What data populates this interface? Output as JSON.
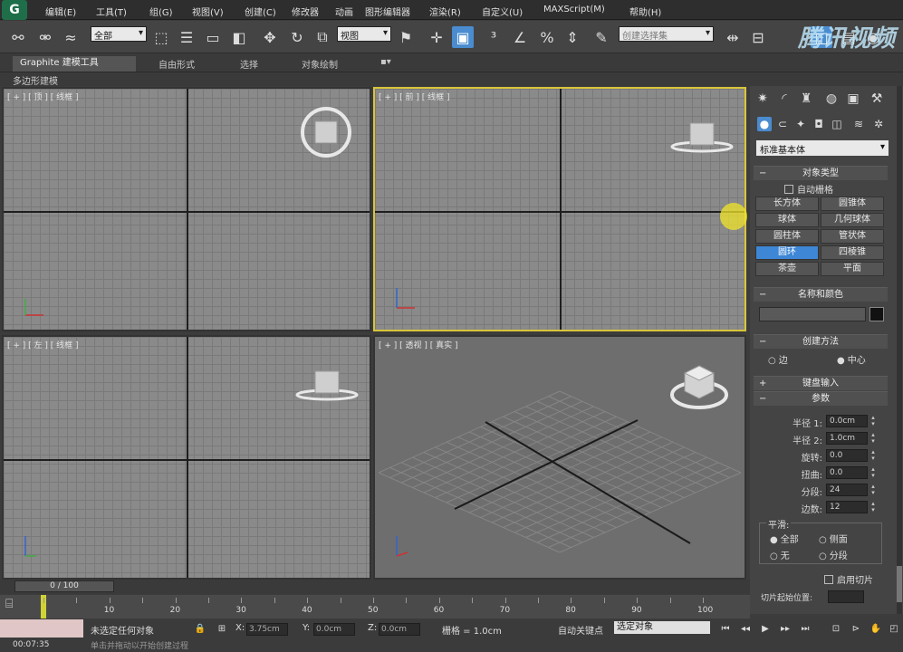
{
  "menu": {
    "logo": "G",
    "items": [
      "编辑(E)",
      "工具(T)",
      "组(G)",
      "视图(V)",
      "创建(C)",
      "修改器",
      "动画",
      "图形编辑器",
      "渲染(R)",
      "自定义(U)",
      "MAXScript(M)",
      "帮助(H)"
    ]
  },
  "toolbar": {
    "selection_filter": "全部",
    "ref_coord": "视图",
    "named_selection": "创建选择集",
    "watermark": "腾讯视频"
  },
  "ribbon": {
    "tabs": [
      "Graphite 建模工具",
      "自由形式",
      "选择",
      "对象绘制"
    ],
    "subtitle": "多边形建模"
  },
  "viewports": {
    "top": "[ + ] [ 顶 ] [ 线框 ]",
    "front": "[ + ] [ 前 ] [ 线框 ]",
    "left": "[ + ] [ 左 ] [ 线框 ]",
    "persp": "[ + ] [ 透视 ] [ 真实 ]"
  },
  "cmdpanel": {
    "category": "标准基本体",
    "object_type": {
      "title": "对象类型",
      "autogrid": "自动栅格",
      "buttons": [
        "长方体",
        "圆锥体",
        "球体",
        "几何球体",
        "圆柱体",
        "管状体",
        "圆环",
        "四棱锥",
        "茶壶",
        "平面"
      ],
      "active_index": 6
    },
    "name_color": {
      "title": "名称和颜色"
    },
    "creation_method": {
      "title": "创建方法",
      "edge": "边",
      "center": "中心"
    },
    "keyboard_entry": "键盘输入",
    "parameters": {
      "title": "参数",
      "fields": [
        {
          "label": "半径 1:",
          "value": "0.0cm"
        },
        {
          "label": "半径 2:",
          "value": "1.0cm"
        },
        {
          "label": "旋转:",
          "value": "0.0"
        },
        {
          "label": "扭曲:",
          "value": "0.0"
        },
        {
          "label": "分段:",
          "value": "24"
        },
        {
          "label": "边数:",
          "value": "12"
        }
      ],
      "smooth_title": "平滑:",
      "smooth_all": "全部",
      "smooth_side": "侧面",
      "smooth_none": "无",
      "smooth_segment": "分段",
      "slice_on": "启用切片",
      "slice_from": "切片起始位置:"
    }
  },
  "timeline": {
    "frame": "0 / 100",
    "ticks": [
      "10",
      "20",
      "30",
      "40",
      "50",
      "60",
      "70",
      "80",
      "90",
      "100"
    ]
  },
  "status": {
    "selection": "未选定任何对象",
    "x_label": "X:",
    "y_label": "Y:",
    "z_label": "Z:",
    "x_value": "3.75cm",
    "y_value": "0.0cm",
    "z_value": "0.0cm",
    "grid": "栅格 = 1.0cm",
    "autokey": "自动关键点",
    "autokey_mode": "选定对象",
    "time": "00:07:35",
    "prompt": "单击并拖动以开始创建过程"
  }
}
